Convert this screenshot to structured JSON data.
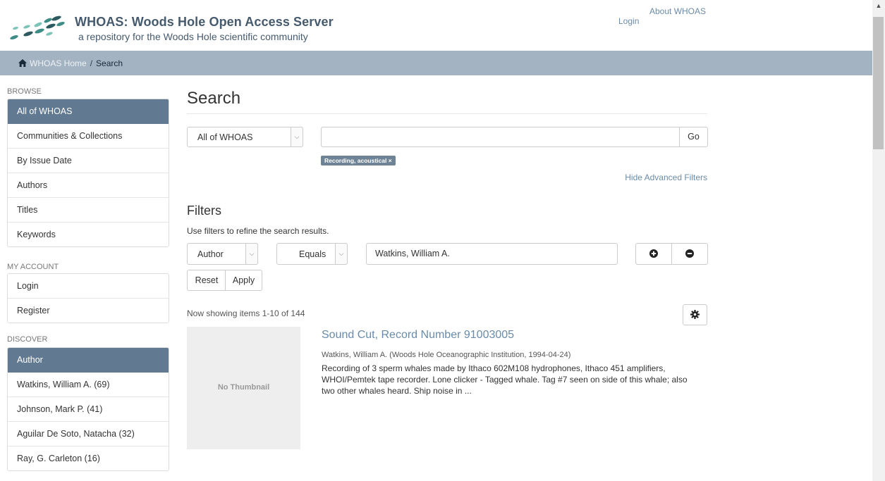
{
  "header": {
    "title_abbr": "WHOAS:",
    "title_rest": "Woods Hole Open Access Server",
    "subtitle": "a repository for the Woods Hole scientific community",
    "login": "Login",
    "about": "About WHOAS"
  },
  "breadcrumb": {
    "home": "WHOAS Home",
    "separator": "/",
    "current": "Search"
  },
  "sidebar": {
    "browse_heading": "BROWSE",
    "browse": [
      {
        "label": "All of WHOAS",
        "active": true
      },
      {
        "label": "Communities & Collections"
      },
      {
        "label": "By Issue Date"
      },
      {
        "label": "Authors"
      },
      {
        "label": "Titles"
      },
      {
        "label": "Keywords"
      }
    ],
    "account_heading": "MY ACCOUNT",
    "account": [
      {
        "label": "Login"
      },
      {
        "label": "Register"
      }
    ],
    "discover_heading": "DISCOVER",
    "discover": [
      {
        "label": "Author",
        "active": true
      },
      {
        "label": "Watkins, William A. (69)"
      },
      {
        "label": "Johnson, Mark P. (41)"
      },
      {
        "label": "Aguilar De Soto, Natacha (32)"
      },
      {
        "label": "Ray, G. Carleton (16)"
      }
    ]
  },
  "search": {
    "title": "Search",
    "scope": "All of WHOAS",
    "query": "",
    "go": "Go",
    "active_tag": "Recording, acoustical ×",
    "hide_filters": "Hide Advanced Filters"
  },
  "filters": {
    "title": "Filters",
    "help": "Use filters to refine the search results.",
    "field": "Author",
    "operator": "Equals",
    "value": "Watkins, William A.",
    "add_icon": "plus-circle-icon",
    "remove_icon": "minus-circle-icon",
    "reset": "Reset",
    "apply": "Apply"
  },
  "results": {
    "showing": "Now showing items 1-10 of 144",
    "settings_icon": "gear-icon",
    "items": [
      {
        "thumbnail": "No Thumbnail",
        "title": "Sound Cut, Record Number 91003005",
        "meta": "Watkins, William A. (Woods Hole Oceanographic Institution, 1994-04-24)",
        "abstract": "Recording of 3 sperm whales made by Ithaco 602M108 hydrophones, Ithaco 451 amplifiers, WHOI/Pemtek tape recorder. Lone clicker - Tagged whale. Tag #7 seen on side of this whale; also two other whales heard. Ship noise in ..."
      }
    ]
  },
  "colors": {
    "accent": "#627a91",
    "breadcrumb_bar": "#a3b3c2",
    "link": "#6a8ba9",
    "logo_dark": "#2c5a5e",
    "logo_mid": "#3d8c86",
    "logo_light": "#7cc3b8"
  }
}
